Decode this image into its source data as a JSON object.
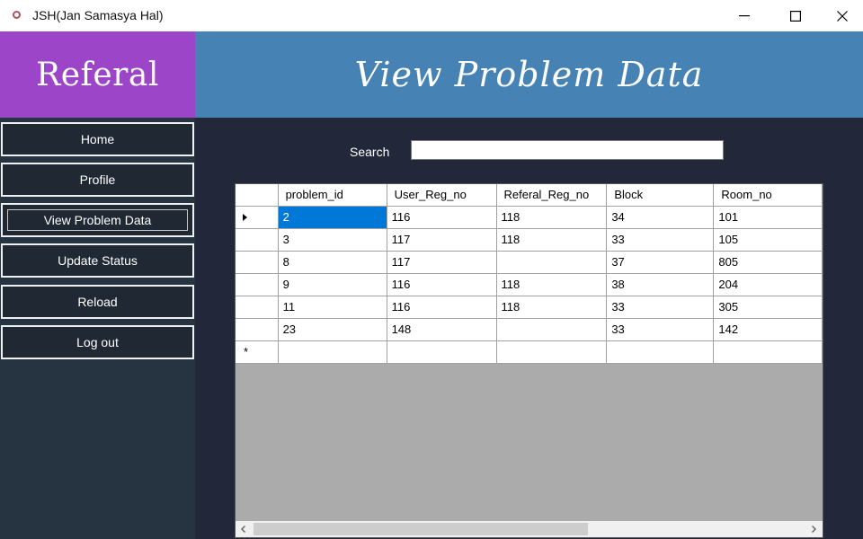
{
  "window": {
    "title": "JSH(Jan Samasya Hal)"
  },
  "header": {
    "brand": "Referal",
    "page_title": "View Problem Data"
  },
  "sidebar": {
    "items": [
      {
        "label": "Home"
      },
      {
        "label": "Profile"
      },
      {
        "label": "View Problem Data"
      },
      {
        "label": "Update Status"
      },
      {
        "label": "Reload"
      },
      {
        "label": "Log out"
      }
    ],
    "active_index": 2
  },
  "search": {
    "label": "Search",
    "value": ""
  },
  "grid": {
    "columns": [
      "problem_id",
      "User_Reg_no",
      "Referal_Reg_no",
      "Block",
      "Room_no"
    ],
    "rows": [
      [
        "2",
        "116",
        "118",
        "34",
        "101"
      ],
      [
        "3",
        "117",
        "118",
        "33",
        "105"
      ],
      [
        "8",
        "117",
        "",
        "37",
        "805"
      ],
      [
        "9",
        "116",
        "118",
        "38",
        "204"
      ],
      [
        "11",
        "116",
        "118",
        "33",
        "305"
      ],
      [
        "23",
        "148",
        "",
        "33",
        "142"
      ]
    ],
    "new_row_marker": "*"
  },
  "icons": {
    "app": "app-icon",
    "minimize": "minimize-icon",
    "maximize": "maximize-icon",
    "close": "close-icon",
    "current_row": "row-pointer-icon",
    "scroll_left": "chevron-left-icon",
    "scroll_right": "chevron-right-icon"
  },
  "colors": {
    "brand_bg": "#9c45c8",
    "banner_bg": "#4682b4",
    "sidebar_bg": "#263442",
    "nav_button_bg": "#1f2833",
    "main_bg": "#222839",
    "grid_empty_bg": "#ababab",
    "selection": "#0078d7"
  }
}
